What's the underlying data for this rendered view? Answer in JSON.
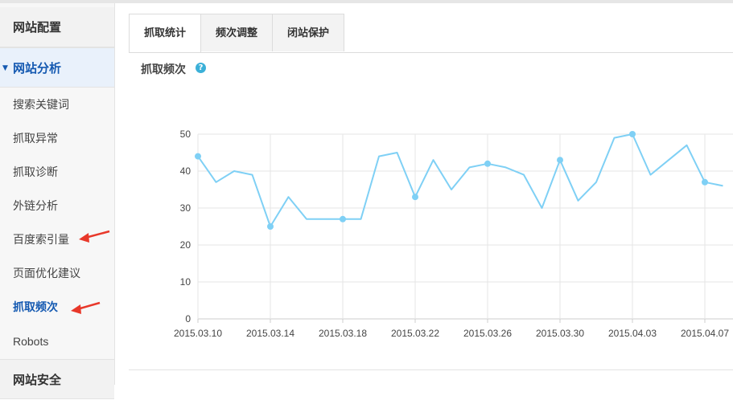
{
  "sidebar": {
    "sections": [
      "网站配置",
      "网站分析",
      "网站安全"
    ],
    "items": [
      "搜索关键词",
      "抓取异常",
      "抓取诊断",
      "外链分析",
      "百度索引量",
      "页面优化建议",
      "抓取频次",
      "Robots"
    ],
    "current_item": "抓取频次"
  },
  "tabs": [
    "抓取统计",
    "频次调整",
    "闭站保护"
  ],
  "active_tab": "抓取统计",
  "section_title": "抓取频次",
  "icons": {
    "help": "help-icon",
    "collapse": "caret-down-icon",
    "annotation": "red-arrow-icon"
  },
  "colors": {
    "line": "#7fd0f5",
    "accent": "#1459b1",
    "arrow": "#e8382a"
  },
  "chart_data": {
    "type": "line",
    "x": [
      "2015.03.10",
      "2015.03.11",
      "2015.03.12",
      "2015.03.13",
      "2015.03.14",
      "2015.03.15",
      "2015.03.16",
      "2015.03.17",
      "2015.03.18",
      "2015.03.19",
      "2015.03.20",
      "2015.03.21",
      "2015.03.22",
      "2015.03.23",
      "2015.03.24",
      "2015.03.25",
      "2015.03.26",
      "2015.03.27",
      "2015.03.28",
      "2015.03.29",
      "2015.03.30",
      "2015.03.31",
      "2015.04.01",
      "2015.04.02",
      "2015.04.03",
      "2015.04.04",
      "2015.04.05",
      "2015.04.06",
      "2015.04.07",
      "2015.04.08"
    ],
    "values": [
      44,
      37,
      40,
      39,
      25,
      33,
      27,
      27,
      27,
      27,
      44,
      45,
      33,
      43,
      35,
      41,
      42,
      41,
      39,
      30,
      43,
      32,
      37,
      49,
      50,
      39,
      43,
      47,
      37,
      36
    ],
    "markers": [
      0,
      4,
      8,
      12,
      16,
      20,
      24,
      28
    ],
    "xticks": [
      "2015.03.10",
      "2015.03.14",
      "2015.03.18",
      "2015.03.22",
      "2015.03.26",
      "2015.03.30",
      "2015.04.03",
      "2015.04.07"
    ],
    "yticks": [
      "50",
      "40",
      "30",
      "20",
      "10",
      "0"
    ],
    "ylim": [
      0,
      50
    ],
    "grid": true
  }
}
